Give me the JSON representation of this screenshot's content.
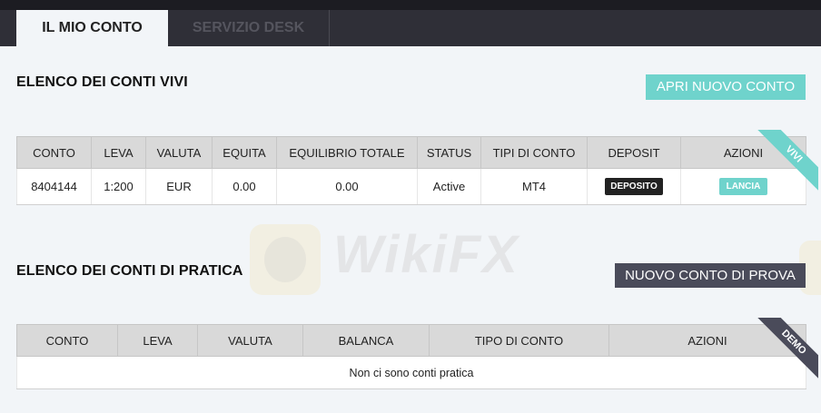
{
  "tabs": {
    "account": "IL MIO CONTO",
    "desk": "SERVIZIO DESK"
  },
  "live": {
    "title": "ELENCO DEI CONTI VIVI",
    "button": "APRI NUOVO CONTO",
    "ribbon": "VIVI",
    "headers": [
      "CONTO",
      "LEVA",
      "VALUTA",
      "EQUITA",
      "EQUILIBRIO TOTALE",
      "STATUS",
      "TIPI DI CONTO",
      "DEPOSIT",
      "AZIONI"
    ],
    "row": {
      "conto": "8404144",
      "leva": "1:200",
      "valuta": "EUR",
      "equita": "0.00",
      "equilibrio": "0.00",
      "status": "Active",
      "tipo": "MT4",
      "deposit": "DEPOSITO",
      "azione": "LANCIA"
    }
  },
  "practice": {
    "title": "ELENCO DEI CONTI DI PRATICA",
    "button": "NUOVO CONTO DI PROVA",
    "ribbon": "DEMO",
    "headers": [
      "CONTO",
      "LEVA",
      "VALUTA",
      "BALANCA",
      "TIPO DI CONTO",
      "AZIONI"
    ],
    "empty": "Non ci sono conti pratica"
  },
  "watermark": {
    "text": "WikiFX"
  },
  "colors": {
    "accent": "#6fd3cc",
    "dark": "#4a4b5a",
    "topbar": "#2f2f37"
  }
}
